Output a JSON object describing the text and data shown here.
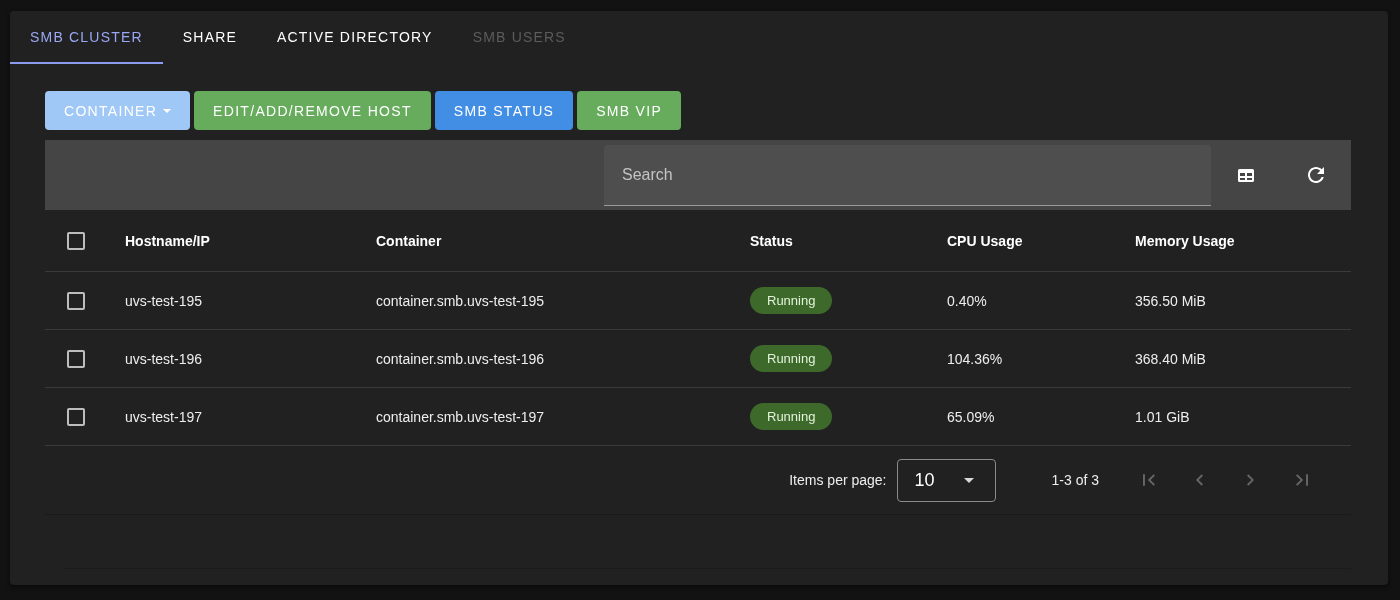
{
  "tabs": [
    {
      "label": "SMB CLUSTER",
      "selected": true,
      "disabled": false
    },
    {
      "label": "SHARE",
      "selected": false,
      "disabled": false
    },
    {
      "label": "ACTIVE DIRECTORY",
      "selected": false,
      "disabled": false
    },
    {
      "label": "SMB USERS",
      "selected": false,
      "disabled": true
    }
  ],
  "buttons": [
    {
      "label": "CONTAINER",
      "kind": "dropdown",
      "color": "#a0c8f6"
    },
    {
      "label": "EDIT/ADD/REMOVE HOST",
      "kind": "action",
      "color": "#66ac5c"
    },
    {
      "label": "SMB STATUS",
      "kind": "action",
      "color": "#438ee5"
    },
    {
      "label": "SMB VIP",
      "kind": "action",
      "color": "#66ac5c"
    }
  ],
  "toolbar": {
    "search": {
      "placeholder": "Search"
    }
  },
  "table": {
    "select_all": {
      "checked": false
    },
    "columns": [
      "Hostname/IP",
      "Container",
      "Status",
      "CPU Usage",
      "Memory Usage"
    ],
    "rows": [
      {
        "checked": false,
        "hostname": "uvs-test-195",
        "container": "container.smb.uvs-test-195",
        "status": "Running",
        "cpu": "0.40%",
        "memory": "356.50 MiB"
      },
      {
        "checked": false,
        "hostname": "uvs-test-196",
        "container": "container.smb.uvs-test-196",
        "status": "Running",
        "cpu": "104.36%",
        "memory": "368.40 MiB"
      },
      {
        "checked": false,
        "hostname": "uvs-test-197",
        "container": "container.smb.uvs-test-197",
        "status": "Running",
        "cpu": "65.09%",
        "memory": "1.01 GiB"
      }
    ]
  },
  "pagination": {
    "label": "Items per page:",
    "page_size": "10",
    "range": "1-3 of 3",
    "nav": [
      {
        "kind": "first",
        "disabled": true
      },
      {
        "kind": "previous",
        "disabled": true
      },
      {
        "kind": "next",
        "disabled": true
      },
      {
        "kind": "last",
        "disabled": true
      }
    ]
  }
}
